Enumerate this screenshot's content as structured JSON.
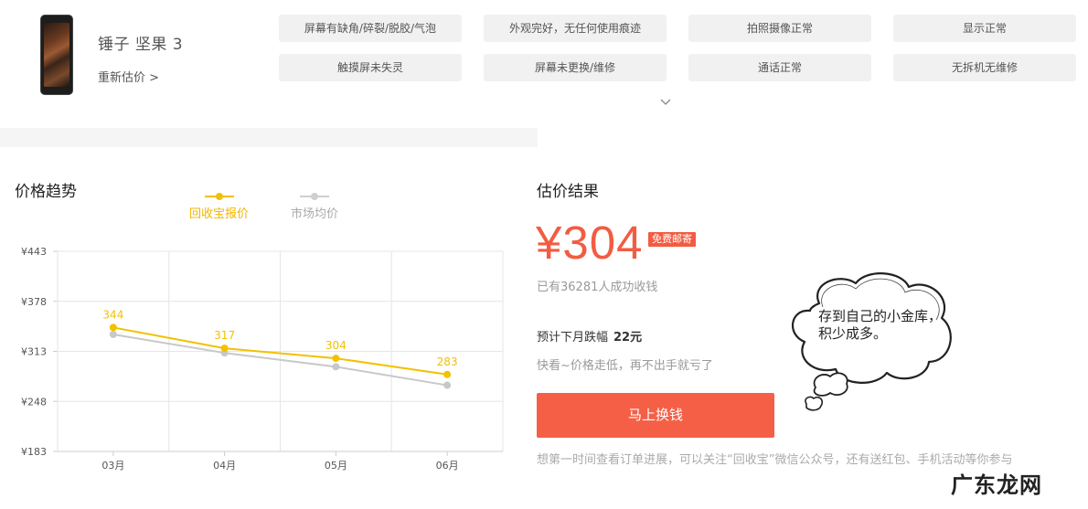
{
  "product": {
    "name": "锤子 坚果 3",
    "reprice_label": "重新估价 >"
  },
  "conditions": [
    "屏幕有缺角/碎裂/脱胶/气泡",
    "外观完好，无任何使用痕迹",
    "拍照摄像正常",
    "显示正常",
    "触摸屏未失灵",
    "屏幕未更换/维修",
    "通话正常",
    "无拆机无维修"
  ],
  "trend": {
    "title": "价格趋势",
    "legend": [
      "回收宝报价",
      "市场均价"
    ]
  },
  "chart_data": {
    "type": "line",
    "categories": [
      "03月",
      "04月",
      "05月",
      "06月"
    ],
    "series": [
      {
        "name": "回收宝报价",
        "color": "#f2c100",
        "values": [
          344,
          317,
          304,
          283
        ],
        "labels": [
          "344",
          "317",
          "304",
          "283"
        ]
      },
      {
        "name": "市场均价",
        "color": "#c8c8c8",
        "values": [
          335,
          311,
          293,
          269
        ]
      }
    ],
    "y_ticks": [
      "¥443",
      "¥378",
      "¥313",
      "¥248",
      "¥183"
    ],
    "ylim": [
      183,
      443
    ],
    "grid": true
  },
  "result": {
    "title": "估价结果",
    "price": "¥304",
    "badge": "免费邮寄",
    "sold_count": "已有36281人成功收钱",
    "drop_label": "预计下月跌幅",
    "drop_value": "22元",
    "hint": "快看~价格走低，再不出手就亏了",
    "cash_button": "马上换钱",
    "footnote": "想第一时间查看订单进展，可以关注“回收宝”微信公众号，还有送红包、手机活动等你参与"
  },
  "bubble_text": "存到自己的小金库，积少成多。",
  "watermark": "广东龙网"
}
